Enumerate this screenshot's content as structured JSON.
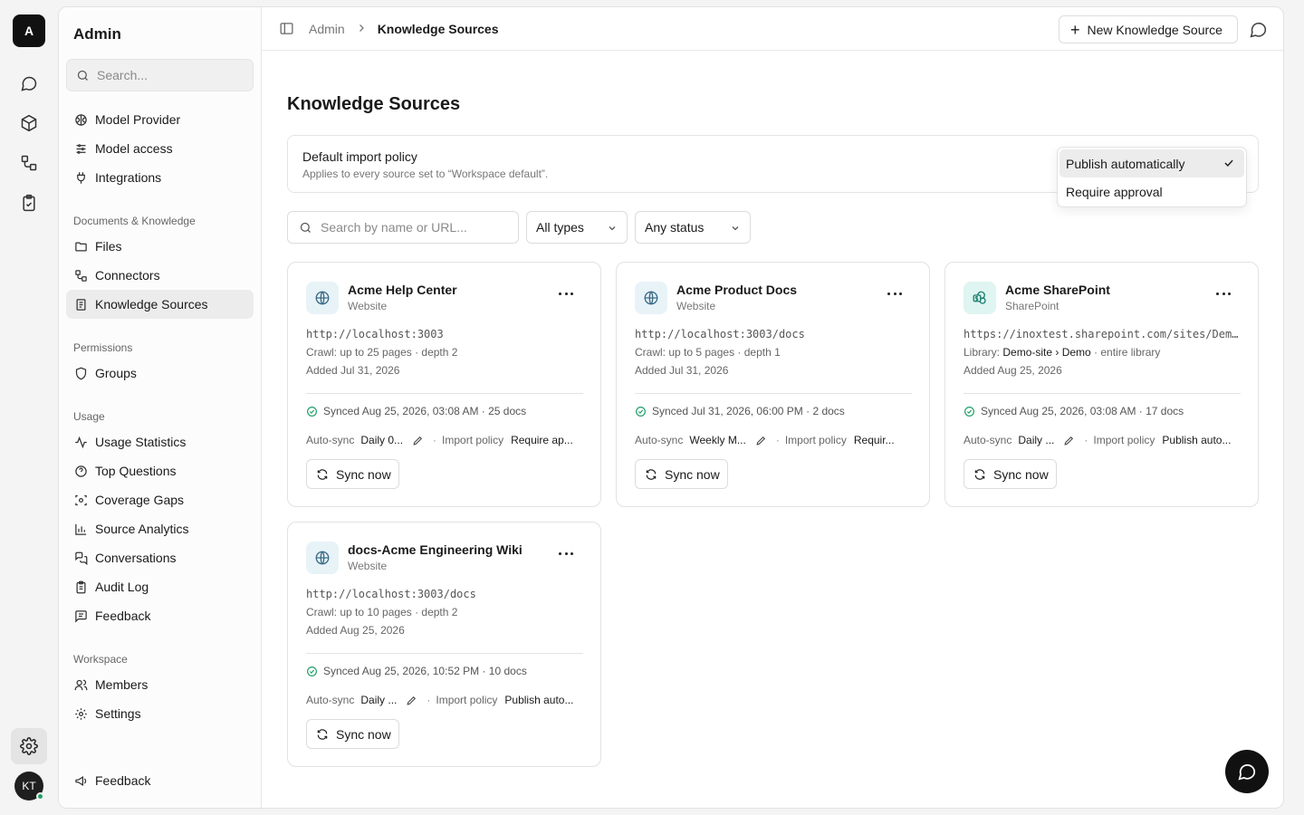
{
  "rail": {
    "logo_letter": "A",
    "avatar_initials": "KT"
  },
  "sidebar": {
    "title": "Admin",
    "search_placeholder": "Search...",
    "top_items": [
      {
        "label": "Model Provider",
        "icon": "brain-icon"
      },
      {
        "label": "Model access",
        "icon": "sliders-icon"
      },
      {
        "label": "Integrations",
        "icon": "plug-icon"
      }
    ],
    "sections": [
      {
        "title": "Documents & Knowledge",
        "items": [
          {
            "label": "Files",
            "icon": "folder-icon"
          },
          {
            "label": "Connectors",
            "icon": "connectors-icon"
          },
          {
            "label": "Knowledge Sources",
            "icon": "book-icon",
            "active": true
          }
        ]
      },
      {
        "title": "Permissions",
        "items": [
          {
            "label": "Groups",
            "icon": "shield-icon"
          }
        ]
      },
      {
        "title": "Usage",
        "items": [
          {
            "label": "Usage Statistics",
            "icon": "activity-icon"
          },
          {
            "label": "Top Questions",
            "icon": "help-circle-icon"
          },
          {
            "label": "Coverage Gaps",
            "icon": "scan-icon"
          },
          {
            "label": "Source Analytics",
            "icon": "bar-chart-icon"
          },
          {
            "label": "Conversations",
            "icon": "messages-icon"
          },
          {
            "label": "Audit Log",
            "icon": "clipboard-icon"
          },
          {
            "label": "Feedback",
            "icon": "message-square-icon"
          }
        ]
      },
      {
        "title": "Workspace",
        "items": [
          {
            "label": "Members",
            "icon": "users-icon"
          },
          {
            "label": "Settings",
            "icon": "gear-icon"
          }
        ]
      }
    ],
    "footer_feedback": "Feedback"
  },
  "topbar": {
    "breadcrumb_root": "Admin",
    "breadcrumb_current": "Knowledge Sources",
    "new_button": "New Knowledge Source"
  },
  "page": {
    "title": "Knowledge Sources",
    "policy": {
      "title": "Default import policy",
      "subtitle": "Applies to every source set to “Workspace default”."
    },
    "policy_options": [
      {
        "label": "Publish automatically",
        "selected": true
      },
      {
        "label": "Require approval",
        "selected": false
      }
    ],
    "filters": {
      "search_placeholder": "Search by name or URL...",
      "type": "All types",
      "status": "Any status"
    }
  },
  "cards": [
    {
      "name": "Acme Help Center",
      "type": "Website",
      "kind": "web",
      "url": "http://localhost:3003",
      "detail": "Crawl: up to 25 pages · depth 2",
      "added": "Added Jul 31, 2026",
      "synced": "Synced Aug 25, 2026, 03:08 AM · 25 docs",
      "auto_label": "Auto-sync",
      "auto_value": "Daily 0...",
      "policy_label": "Import policy",
      "policy_value": "Require ap...",
      "sync_label": "Sync now"
    },
    {
      "name": "Acme Product Docs",
      "type": "Website",
      "kind": "web",
      "url": "http://localhost:3003/docs",
      "detail": "Crawl: up to 5 pages · depth 1",
      "added": "Added Jul 31, 2026",
      "synced": "Synced Jul 31, 2026, 06:00 PM · 2 docs",
      "auto_label": "Auto-sync",
      "auto_value": "Weekly M...",
      "policy_label": "Import policy",
      "policy_value": "Requir...",
      "sync_label": "Sync now"
    },
    {
      "name": "Acme SharePoint",
      "type": "SharePoint",
      "kind": "sharepoint",
      "url": "https://inoxtest.sharepoint.com/sites/Demo-site",
      "detail_prefix": "Library: ",
      "detail_strong": "Demo-site › Demo",
      "detail_suffix": " · entire library",
      "added": "Added Aug 25, 2026",
      "synced": "Synced Aug 25, 2026, 03:08 AM · 17 docs",
      "auto_label": "Auto-sync",
      "auto_value": "Daily ...",
      "policy_label": "Import policy",
      "policy_value": "Publish auto...",
      "sync_label": "Sync now"
    },
    {
      "name": "docs-Acme Engineering Wiki",
      "type": "Website",
      "kind": "web",
      "url": "http://localhost:3003/docs",
      "detail": "Crawl: up to 10 pages · depth 2",
      "added": "Added Aug 25, 2026",
      "synced": "Synced Aug 25, 2026, 10:52 PM · 10 docs",
      "auto_label": "Auto-sync",
      "auto_value": "Daily ...",
      "policy_label": "Import policy",
      "policy_value": "Publish auto...",
      "sync_label": "Sync now"
    }
  ],
  "colors": {
    "accent": "#111111",
    "synced_ok": "#22a06b",
    "active_bg": "#ececec"
  }
}
